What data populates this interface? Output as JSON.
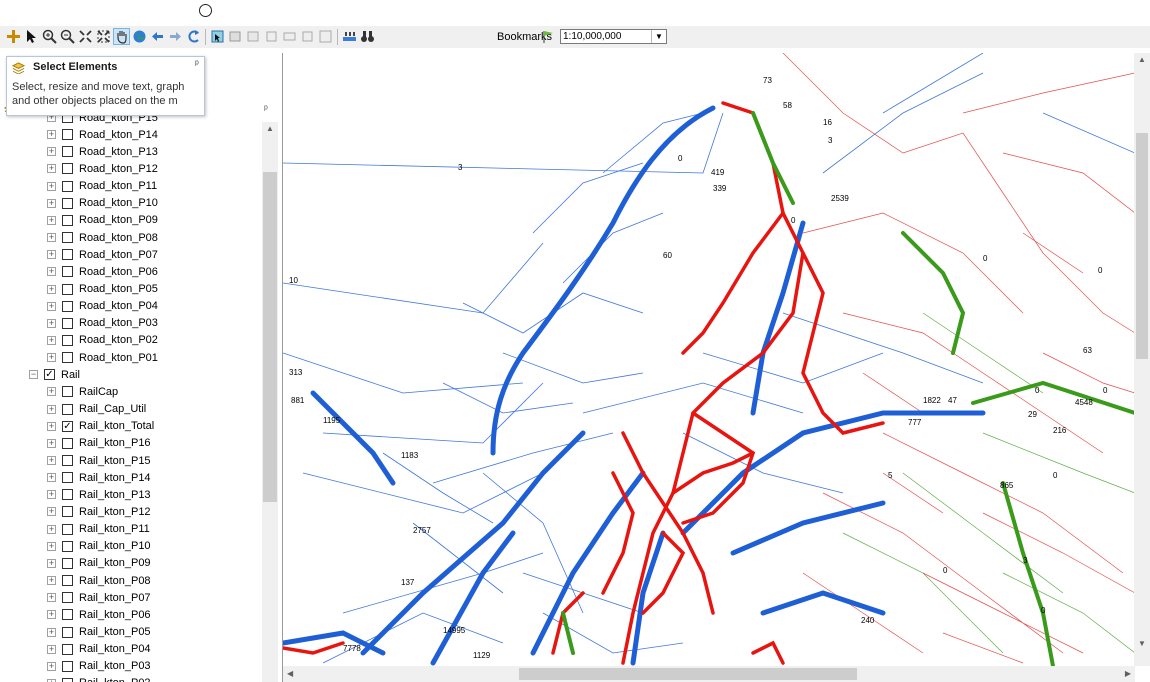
{
  "toolbar": {
    "buttons": [
      {
        "name": "add-data",
        "icon": "plus-icon"
      },
      {
        "name": "select",
        "icon": "arrow-cursor-icon"
      },
      {
        "name": "zoom-in",
        "icon": "zoom-in-icon"
      },
      {
        "name": "zoom-out",
        "icon": "zoom-out-icon"
      },
      {
        "name": "fixed-zoom-in",
        "icon": "fixed-zoom-in-icon"
      },
      {
        "name": "fixed-zoom-out",
        "icon": "fixed-zoom-out-icon"
      },
      {
        "name": "pan",
        "icon": "hand-icon"
      },
      {
        "name": "full-extent",
        "icon": "globe-icon"
      },
      {
        "name": "back",
        "icon": "arrow-left-icon"
      },
      {
        "name": "forward",
        "icon": "arrow-right-icon"
      },
      {
        "name": "refresh",
        "icon": "refresh-icon"
      },
      {
        "name": "select-features",
        "icon": "select-features-icon"
      },
      {
        "name": "clear-selection",
        "icon": "clear-selection-icon"
      },
      {
        "name": "identify",
        "icon": "identify-icon"
      },
      {
        "name": "find",
        "icon": "binoculars-icon"
      }
    ],
    "bookmarks_label": "Bookmarks",
    "scale_value": "1:10,000,000"
  },
  "tooltip": {
    "title": "Select Elements",
    "body_line1": "Select, resize and move text, graph",
    "body_line2": "and other objects placed on the m"
  },
  "toc": {
    "layers": [
      {
        "label": "Road_kton_P15",
        "checked": false,
        "level": 1,
        "partial": true
      },
      {
        "label": "Road_kton_P14",
        "checked": false,
        "level": 1
      },
      {
        "label": "Road_kton_P13",
        "checked": false,
        "level": 1
      },
      {
        "label": "Road_kton_P12",
        "checked": false,
        "level": 1
      },
      {
        "label": "Road_kton_P11",
        "checked": false,
        "level": 1
      },
      {
        "label": "Road_kton_P10",
        "checked": false,
        "level": 1
      },
      {
        "label": "Road_kton_P09",
        "checked": false,
        "level": 1
      },
      {
        "label": "Road_kton_P08",
        "checked": false,
        "level": 1
      },
      {
        "label": "Road_kton_P07",
        "checked": false,
        "level": 1
      },
      {
        "label": "Road_kton_P06",
        "checked": false,
        "level": 1
      },
      {
        "label": "Road_kton_P05",
        "checked": false,
        "level": 1
      },
      {
        "label": "Road_kton_P04",
        "checked": false,
        "level": 1
      },
      {
        "label": "Road_kton_P03",
        "checked": false,
        "level": 1
      },
      {
        "label": "Road_kton_P02",
        "checked": false,
        "level": 1
      },
      {
        "label": "Road_kton_P01",
        "checked": false,
        "level": 1
      },
      {
        "label": "Rail",
        "checked": true,
        "level": 0,
        "expanded": true
      },
      {
        "label": "RailCap",
        "checked": false,
        "level": 1
      },
      {
        "label": "Rail_Cap_Util",
        "checked": false,
        "level": 1
      },
      {
        "label": "Rail_kton_Total",
        "checked": true,
        "level": 1
      },
      {
        "label": "Rail_kton_P16",
        "checked": false,
        "level": 1
      },
      {
        "label": "Rail_kton_P15",
        "checked": false,
        "level": 1
      },
      {
        "label": "Rail_kton_P14",
        "checked": false,
        "level": 1
      },
      {
        "label": "Rail_kton_P13",
        "checked": false,
        "level": 1
      },
      {
        "label": "Rail_kton_P12",
        "checked": false,
        "level": 1
      },
      {
        "label": "Rail_kton_P11",
        "checked": false,
        "level": 1
      },
      {
        "label": "Rail_kton_P10",
        "checked": false,
        "level": 1
      },
      {
        "label": "Rail_kton_P09",
        "checked": false,
        "level": 1
      },
      {
        "label": "Rail_kton_P08",
        "checked": false,
        "level": 1
      },
      {
        "label": "Rail_kton_P07",
        "checked": false,
        "level": 1
      },
      {
        "label": "Rail_kton_P06",
        "checked": false,
        "level": 1
      },
      {
        "label": "Rail_kton_P05",
        "checked": false,
        "level": 1
      },
      {
        "label": "Rail_kton_P04",
        "checked": false,
        "level": 1
      },
      {
        "label": "Rail_kton_P03",
        "checked": false,
        "level": 1
      },
      {
        "label": "Rail_kton_P02",
        "checked": false,
        "level": 1
      }
    ]
  },
  "map": {
    "colors": {
      "sea": "#1f5fd6",
      "rail": "#e8140f",
      "road": "#3a9a1a",
      "border": "#c0392b"
    },
    "labels": [
      "3",
      "0",
      "10",
      "313",
      "881",
      "1195",
      "1183",
      "2757",
      "137",
      "14995",
      "1129",
      "7778",
      "240",
      "0",
      "0",
      "29",
      "216",
      "4548",
      "0",
      "865",
      "777",
      "0",
      "5",
      "0",
      "3",
      "0",
      "419",
      "339",
      "60",
      "0",
      "2539",
      "73",
      "58",
      "16",
      "3",
      "63",
      "0",
      "1822",
      "47"
    ]
  }
}
